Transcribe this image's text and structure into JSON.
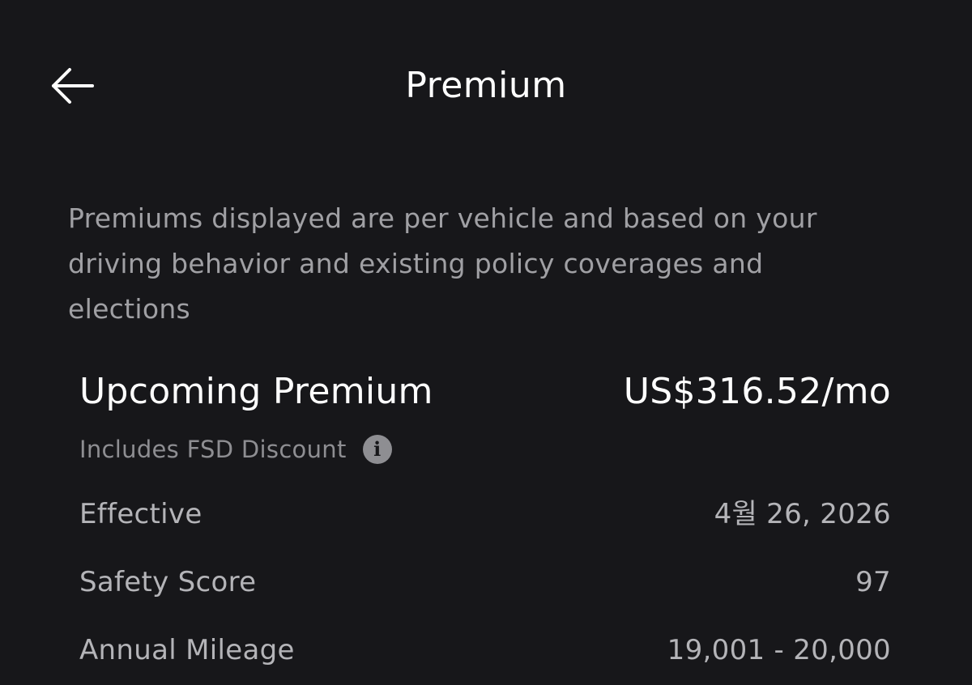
{
  "header": {
    "title": "Premium",
    "back_icon": "arrow-left-icon"
  },
  "disclaimer": "Premiums displayed are per vehicle and based on your driving behavior and existing policy coverages and elections",
  "upcoming_premium": {
    "label": "Upcoming Premium",
    "value": "US$316.52/mo",
    "note": "Includes FSD Discount",
    "note_icon": "info-icon"
  },
  "details": {
    "effective": {
      "label": "Effective",
      "value": "4월 26, 2026"
    },
    "safety_score": {
      "label": "Safety Score",
      "value": "97"
    },
    "annual_mileage": {
      "label": "Annual Mileage",
      "value": "19,001 - 20,000"
    }
  },
  "colors": {
    "background": "#17171a",
    "primary_text": "#ffffff",
    "secondary_text": "#a0a0a4"
  }
}
